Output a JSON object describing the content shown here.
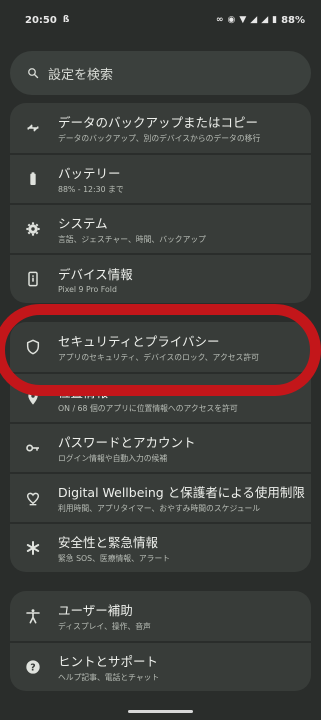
{
  "status": {
    "time": "20:50",
    "battery": "88%"
  },
  "search": {
    "placeholder": "設定を検索"
  },
  "groups": [
    {
      "items": [
        {
          "icon": "backup-icon",
          "title": "データのバックアップまたはコピー",
          "subtitle": "データのバックアップ、別のデバイスからのデータの移行"
        },
        {
          "icon": "battery-icon",
          "title": "バッテリー",
          "subtitle": "88% - 12:30 まで"
        },
        {
          "icon": "gear-icon",
          "title": "システム",
          "subtitle": "言語、ジェスチャー、時間、バックアップ"
        },
        {
          "icon": "phone-info-icon",
          "title": "デバイス情報",
          "subtitle": "Pixel 9 Pro Fold"
        }
      ]
    },
    {
      "items": [
        {
          "icon": "shield-icon",
          "title": "セキュリティとプライバシー",
          "subtitle": "アプリのセキュリティ、デバイスのロック、アクセス許可"
        },
        {
          "icon": "location-pin-icon",
          "title": "位置情報",
          "subtitle": "ON / 68 個のアプリに位置情報へのアクセスを許可"
        },
        {
          "icon": "key-icon",
          "title": "パスワードとアカウント",
          "subtitle": "ログイン情報や自動入力の候補"
        },
        {
          "icon": "wellbeing-icon",
          "title": "Digital Wellbeing と保護者による使用制限",
          "subtitle": "利用時間、アプリタイマー、おやすみ時間のスケジュール"
        },
        {
          "icon": "asterisk-icon",
          "title": "安全性と緊急情報",
          "subtitle": "緊急 SOS、医療情報、アラート"
        }
      ]
    },
    {
      "items": [
        {
          "icon": "accessibility-icon",
          "title": "ユーザー補助",
          "subtitle": "ディスプレイ、操作、音声"
        },
        {
          "icon": "help-icon",
          "title": "ヒントとサポート",
          "subtitle": "ヘルプ記事、電話とチャット"
        }
      ]
    }
  ],
  "colors": {
    "background": "#2a2d2b",
    "card": "#383c39",
    "highlight": "#c3161a"
  }
}
